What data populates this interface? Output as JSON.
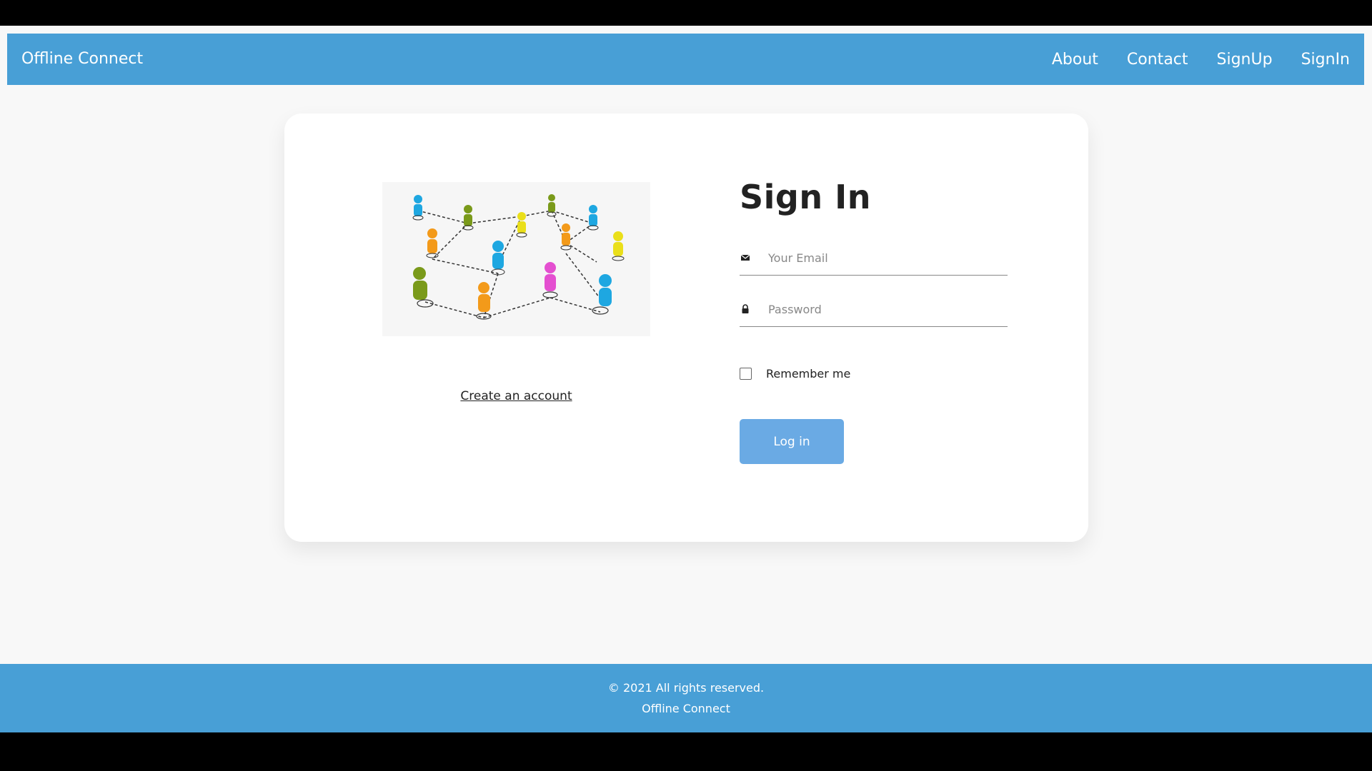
{
  "navbar": {
    "brand": "Offline Connect",
    "links": [
      "About",
      "Contact",
      "SignUp",
      "SignIn"
    ]
  },
  "illustration": {
    "icon": "people-network-illustration"
  },
  "signin": {
    "title": "Sign In",
    "email_placeholder": "Your Email",
    "password_placeholder": "Password",
    "remember_label": "Remember me",
    "login_label": "Log in",
    "create_account": "Create an account"
  },
  "footer": {
    "copyright": "© 2021 All rights reserved.",
    "name": "Offline Connect"
  },
  "colors": {
    "primary": "#489fd6",
    "button": "#6aaae4",
    "background": "#f8f8f8"
  }
}
